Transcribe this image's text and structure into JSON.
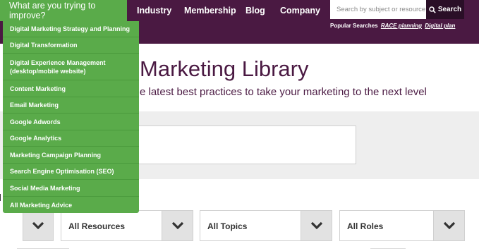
{
  "nav": {
    "trigger_label": "What are you trying to improve?",
    "links": [
      "Industry",
      "Membership",
      "Blog",
      "Company"
    ]
  },
  "search": {
    "placeholder": "Search by subject or resource",
    "button_label": "Search",
    "popular_label": "Popular Searches",
    "popular_links": [
      "RACE planning",
      "Digital plan"
    ]
  },
  "hero": {
    "title": "Marketing Library",
    "subtitle": "e latest best practices to take your marketing to the next level"
  },
  "filters": [
    "All Resources",
    "All Topics",
    "All Roles"
  ],
  "dropdown": {
    "items": [
      "Digital Marketing Strategy and Planning",
      "Digital Transformation",
      "Digital Experience Management (desktop/mobile website)",
      "Content Marketing",
      "Email Marketing",
      "Google Adwords",
      "Google Analytics",
      "Marketing Campaign Planning",
      "Search Engine Optimisation (SEO)",
      "Social Media Marketing",
      "All Marketing Advice"
    ]
  },
  "colors": {
    "brand": "#4a1942",
    "accent": "#5aab4a",
    "search_button": "#2a0f27"
  },
  "icons": {
    "search": "search-icon",
    "chevron": "chevron-down-icon"
  }
}
